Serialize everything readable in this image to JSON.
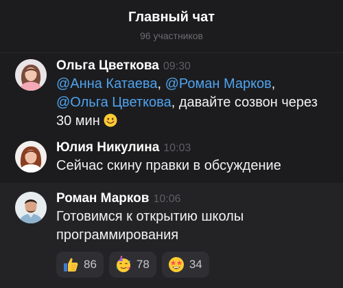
{
  "chat": {
    "title": "Главный чат",
    "members": "96 участников"
  },
  "messages": [
    {
      "author": "Ольга Цветкова",
      "time": "09:30",
      "mention_1": "@Анна Катаева",
      "sep_1": ", ",
      "mention_2": "@Роман Марков",
      "sep_2": ",",
      "mention_3": "@Ольга Цветкова",
      "text": ", давайте созвон через 30 мин",
      "emoji": "smiling-face-icon",
      "avatar": "avatar-olga"
    },
    {
      "author": "Юлия Никулина",
      "time": "10:03",
      "text": "Сейчас скину правки в обсуждение",
      "avatar": "avatar-yulia"
    },
    {
      "author": "Роман Марков",
      "time": "10:06",
      "text": "Готовимся к открытию школы программирования",
      "avatar": "avatar-roman"
    }
  ],
  "reactions": [
    {
      "icon": "thumbs-up-icon",
      "count": "86"
    },
    {
      "icon": "partying-face-icon",
      "count": "78"
    },
    {
      "icon": "star-struck-icon",
      "count": "34"
    }
  ],
  "colors": {
    "background": "#1c1c1e",
    "mention": "#4fa4f0",
    "timestamp": "#5e5e63",
    "reaction_bg": "#2f2f33"
  }
}
